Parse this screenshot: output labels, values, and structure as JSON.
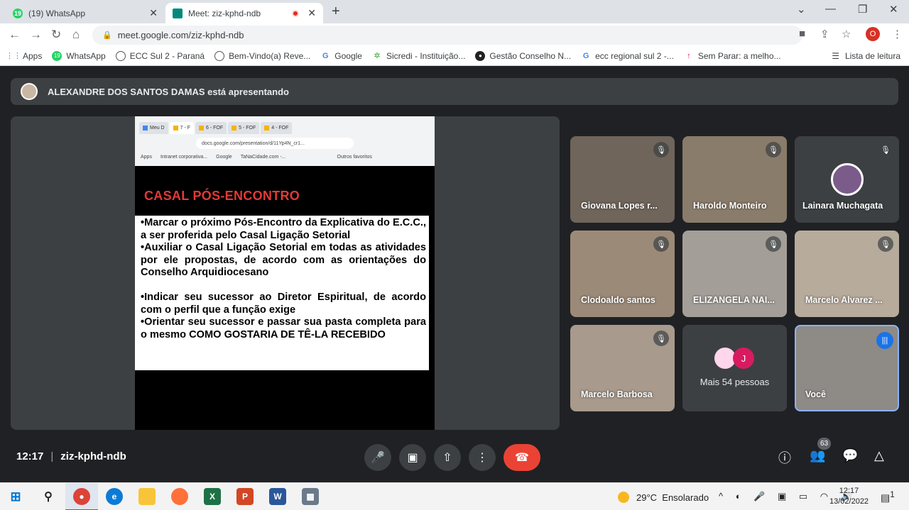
{
  "browser": {
    "tabs": [
      {
        "title": "(19) WhatsApp",
        "fav_color": "#25d366",
        "fav_text": "19"
      },
      {
        "title": "Meet: ziz-kphd-ndb",
        "fav_color": "#00897b",
        "fav_text": ""
      }
    ],
    "url": "meet.google.com/ziz-kphd-ndb",
    "profile_initial": "O",
    "bookmarks": [
      {
        "label": "Apps",
        "icon": "apps-grid-icon"
      },
      {
        "label": "WhatsApp",
        "icon": "whatsapp-icon"
      },
      {
        "label": "ECC Sul 2 - Paraná",
        "icon": "globe-icon"
      },
      {
        "label": "Bem-Vindo(a) Reve...",
        "icon": "globe-icon"
      },
      {
        "label": "Google",
        "icon": "google-icon"
      },
      {
        "label": "Sicredi - Instituição...",
        "icon": "sicredi-icon"
      },
      {
        "label": "Gestão Conselho N...",
        "icon": "ecc-icon"
      },
      {
        "label": "ecc regional sul 2 -...",
        "icon": "google-icon"
      },
      {
        "label": "Sem Parar: a melho...",
        "icon": "arrow-up-icon"
      }
    ],
    "reading_list": "Lista de leitura"
  },
  "meet": {
    "presenting_banner": "ALEXANDRE DOS SANTOS DAMAS está apresentando",
    "slide": {
      "inner_tabs": [
        "Meu D",
        "7 - F",
        "6 - FOF",
        "5 - FOF",
        "4 - FOF"
      ],
      "inner_url": "docs.google.com/presentation/d/11Yp4N_cr1...",
      "inner_bookmarks": [
        "Apps",
        "Intranet corporativa...",
        "Google",
        "TaNaCidade.com -...",
        "Outros favoritos"
      ],
      "title": "CASAL PÓS-ENCONTRO",
      "paragraphs": [
        "•Marcar o próximo Pós-Encontro da Explicativa do E.C.C., a ser proferida pelo Casal Ligação Setorial",
        "•Auxiliar o Casal Ligação Setorial em todas as atividades por ele propostas, de acordo com as orientações do Conselho Arquidiocesano",
        "•Indicar seu sucessor ao Diretor Espiritual, de acordo com o perfil que a função exige",
        "•Orientar seu sucessor e passar sua pasta completa para o mesmo COMO GOSTARIA DE TÊ-LA RECEBIDO"
      ]
    },
    "participants": [
      {
        "name": "Giovana Lopes r...",
        "muted": true
      },
      {
        "name": "Haroldo Monteiro",
        "muted": true
      },
      {
        "name": "Lainara Muchagata",
        "muted": true
      },
      {
        "name": "Clodoaldo santos",
        "muted": true
      },
      {
        "name": "ELIZANGELA NAI...",
        "muted": true
      },
      {
        "name": "Marcelo Alvarez ...",
        "muted": true
      },
      {
        "name": "Marcelo Barbosa",
        "muted": true
      },
      {
        "name": "Mais 54 pessoas",
        "avatar_letter": "J"
      },
      {
        "name": "Você",
        "speaking": true
      }
    ],
    "time": "12:17",
    "meeting_code": "ziz-kphd-ndb",
    "people_count": "63"
  },
  "taskbar": {
    "weather_temp": "29°C",
    "weather_text": "Ensolarado",
    "clock_time": "12:17",
    "clock_date": "13/02/2022",
    "notif_count": "1"
  }
}
